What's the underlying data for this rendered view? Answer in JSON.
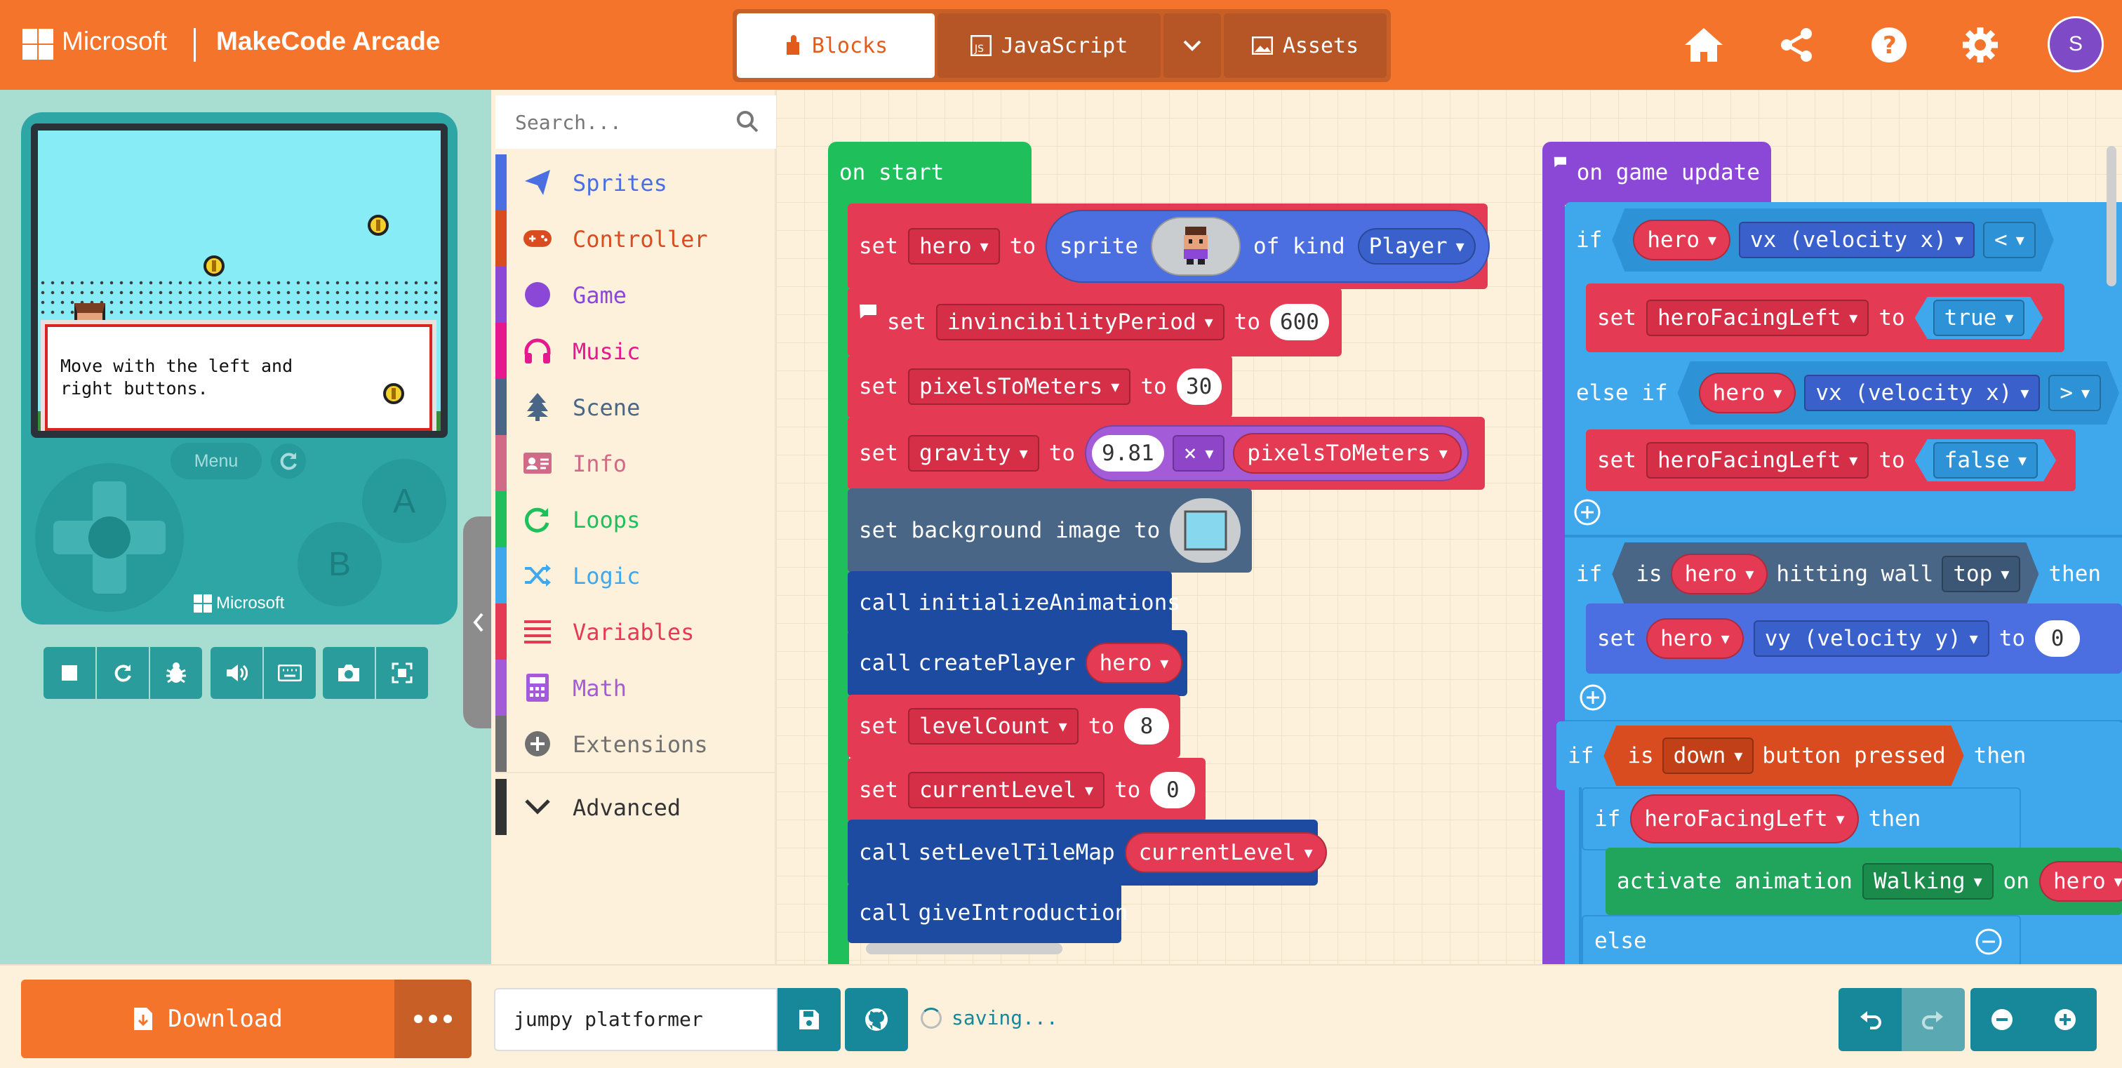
{
  "header": {
    "brand": "Microsoft",
    "app_title": "MakeCode Arcade",
    "tabs": {
      "blocks": "Blocks",
      "javascript": "JavaScript",
      "assets": "Assets"
    },
    "user_initial": "S",
    "icons": [
      "home-icon",
      "share-icon",
      "help-icon",
      "settings-icon"
    ]
  },
  "simulator": {
    "dialog_text": "Move with the left and\nright buttons.",
    "menu_label": "Menu",
    "a_label": "A",
    "b_label": "B",
    "console_brand": "Microsoft",
    "toolbar_icons": [
      "stop-icon",
      "restart-icon",
      "debug-icon",
      "sound-icon",
      "keyboard-icon",
      "screenshot-icon",
      "fullscreen-icon"
    ]
  },
  "toolbox": {
    "search_placeholder": "Search...",
    "categories": [
      {
        "label": "Sprites",
        "color": "#4b6fe0"
      },
      {
        "label": "Controller",
        "color": "#d94c1f"
      },
      {
        "label": "Game",
        "color": "#8b48d6"
      },
      {
        "label": "Music",
        "color": "#e6188e"
      },
      {
        "label": "Scene",
        "color": "#4a6687"
      },
      {
        "label": "Info",
        "color": "#cf6a87"
      },
      {
        "label": "Loops",
        "color": "#1fbf5b"
      },
      {
        "label": "Logic",
        "color": "#3fa8ec"
      },
      {
        "label": "Variables",
        "color": "#e43a54"
      },
      {
        "label": "Math",
        "color": "#a45bd8"
      },
      {
        "label": "Extensions",
        "color": "#707070"
      },
      {
        "label": "Advanced",
        "color": "#333333"
      }
    ]
  },
  "workspace": {
    "on_start": {
      "header": "on start",
      "set_hero": {
        "set": "set",
        "var": "hero",
        "to": "to",
        "sprite": "sprite",
        "of_kind": "of kind",
        "kind": "Player"
      },
      "set_invincibility": {
        "set": "set",
        "var": "invincibilityPeriod",
        "to": "to",
        "value": "600"
      },
      "set_pixels": {
        "set": "set",
        "var": "pixelsToMeters",
        "to": "to",
        "value": "30"
      },
      "set_gravity": {
        "set": "set",
        "var": "gravity",
        "to": "to",
        "left": "9.81",
        "op": "×",
        "right": "pixelsToMeters"
      },
      "set_background": "set background image to",
      "call_init": {
        "call": "call",
        "fn": "initializeAnimations"
      },
      "call_create": {
        "call": "call",
        "fn": "createPlayer",
        "arg": "hero"
      },
      "set_levelcount": {
        "set": "set",
        "var": "levelCount",
        "to": "to",
        "value": "8"
      },
      "set_current": {
        "set": "set",
        "var": "currentLevel",
        "to": "to",
        "value": "0"
      },
      "call_tilemap": {
        "call": "call",
        "fn": "setLevelTileMap",
        "arg": "currentLevel"
      },
      "call_intro": {
        "call": "call",
        "fn": "giveIntroduction"
      }
    },
    "on_update": {
      "header": "on game update",
      "if1": {
        "kw": "if",
        "sprite": "hero",
        "prop": "vx (velocity x)",
        "op": "<"
      },
      "set_left_true": {
        "set": "set",
        "var": "heroFacingLeft",
        "to": "to",
        "value": "true"
      },
      "elseif": {
        "kw": "else if",
        "sprite": "hero",
        "prop": "vx (velocity x)",
        "op": ">"
      },
      "set_left_false": {
        "set": "set",
        "var": "heroFacingLeft",
        "to": "to",
        "value": "false"
      },
      "if2": {
        "kw": "if",
        "is": "is",
        "sprite": "hero",
        "hitting": "hitting wall",
        "dir": "top",
        "then": "then"
      },
      "set_vy": {
        "set": "set",
        "sprite": "hero",
        "prop": "vy (velocity y)",
        "to": "to",
        "value": "0"
      },
      "if3": {
        "kw": "if",
        "is": "is",
        "button": "down",
        "pressed": "button pressed",
        "then": "then"
      },
      "if4": {
        "kw": "if",
        "var": "heroFacingLeft",
        "then": "then"
      },
      "activate": {
        "text": "activate animation",
        "anim": "Walking",
        "on": "on",
        "sprite": "hero"
      },
      "else": "else"
    }
  },
  "bottombar": {
    "download_label": "Download",
    "project_name": "jumpy platformer",
    "status": "saving..."
  }
}
